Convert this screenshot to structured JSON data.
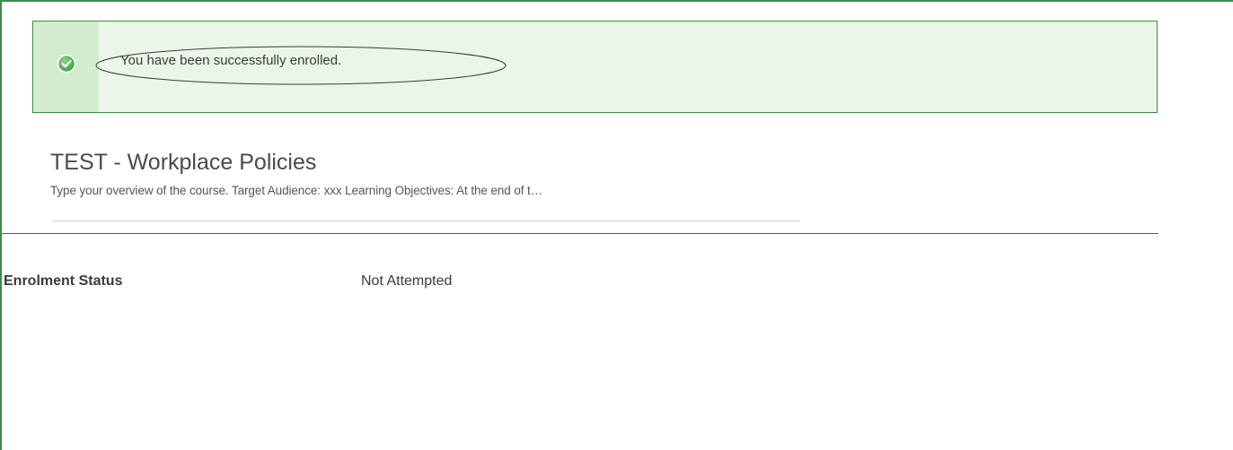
{
  "alert": {
    "message": "You have been successfully enrolled.",
    "icon": "check-circle-icon",
    "colors": {
      "background": "#eaf6e8",
      "strip": "#d4ecce",
      "border": "#3c8d3c",
      "icon": "#5bb75b"
    }
  },
  "course": {
    "title": "TEST - Workplace Policies",
    "description": "Type your overview of the course. Target Audience: xxx Learning Objectives: At the end of t…"
  },
  "enrolment": {
    "label": "Enrolment Status",
    "value": "Not Attempted"
  }
}
